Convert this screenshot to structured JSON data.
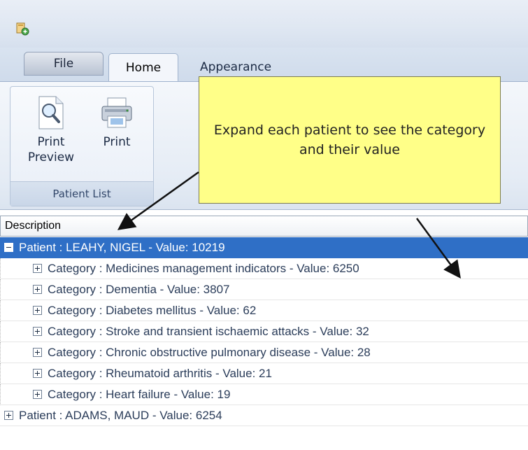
{
  "ribbon": {
    "tabs": [
      "File",
      "Home",
      "Appearance"
    ],
    "print_preview_label": "Print Preview",
    "print_label": "Print",
    "group_label": "Patient List"
  },
  "callout": {
    "text": "Expand each patient to see the category and their value"
  },
  "tree": {
    "column_header": "Description",
    "rows": [
      {
        "text": "Patient : LEAHY, NIGEL - Value: 10219",
        "level": 0,
        "expanded": true,
        "selected": true
      },
      {
        "text": "Category : Medicines management indicators - Value: 6250",
        "level": 1,
        "expanded": false
      },
      {
        "text": "Category : Dementia - Value: 3807",
        "level": 1,
        "expanded": false
      },
      {
        "text": "Category : Diabetes mellitus - Value: 62",
        "level": 1,
        "expanded": false
      },
      {
        "text": "Category : Stroke and transient ischaemic attacks - Value: 32",
        "level": 1,
        "expanded": false
      },
      {
        "text": "Category : Chronic obstructive pulmonary disease - Value: 28",
        "level": 1,
        "expanded": false
      },
      {
        "text": "Category : Rheumatoid arthritis - Value: 21",
        "level": 1,
        "expanded": false
      },
      {
        "text": "Category : Heart failure - Value: 19",
        "level": 1,
        "expanded": false
      },
      {
        "text": "Patient : ADAMS, MAUD - Value: 6254",
        "level": 0,
        "expanded": false
      }
    ]
  },
  "colors": {
    "selection": "#2f6fc6",
    "callout_fill": "#ffff88"
  }
}
